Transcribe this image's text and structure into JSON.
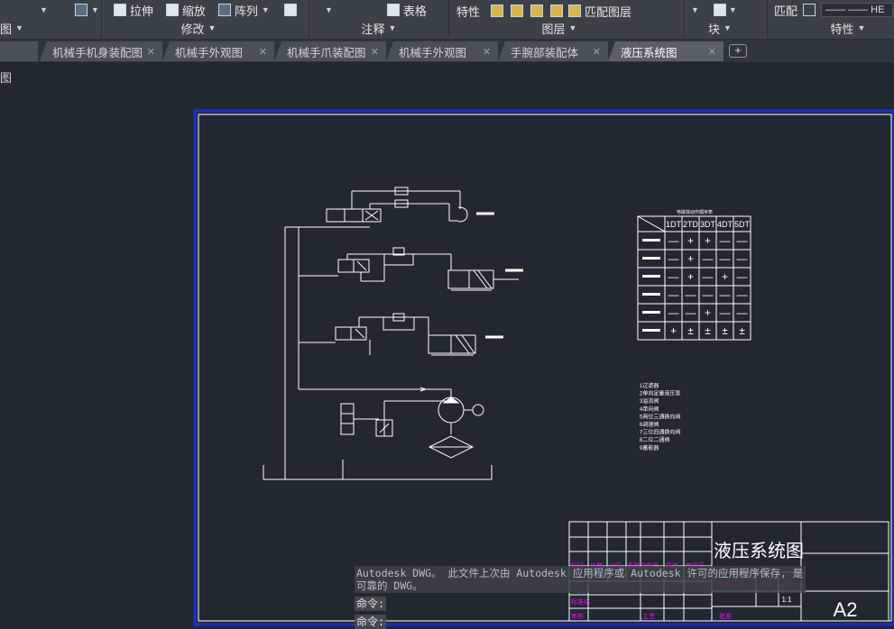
{
  "ribbon": {
    "row1": [
      {
        "name": "view-dropdown",
        "label": ""
      },
      {
        "name": "stretch-button",
        "label": "拉伸"
      },
      {
        "name": "scale-button",
        "label": "缩放"
      },
      {
        "name": "array-button",
        "label": "阵列"
      },
      {
        "name": "table-button",
        "label": "表格"
      },
      {
        "name": "properties-label-top",
        "label": "特性"
      },
      {
        "name": "match-layer-button",
        "label": "匹配图层"
      },
      {
        "name": "match-button",
        "label": "匹配"
      },
      {
        "name": "linetype-label",
        "label": "HE"
      }
    ],
    "panels": {
      "left_cut": "图",
      "modify": "修改",
      "annotation": "注释",
      "layers": "图层",
      "block": "块",
      "properties": "特性"
    }
  },
  "tabs": [
    {
      "label": "机械手机身装配图",
      "active": false
    },
    {
      "label": "机械手外观图",
      "active": false
    },
    {
      "label": "机械手爪装配图",
      "active": false
    },
    {
      "label": "机械手外观图",
      "active": false
    },
    {
      "label": "手腕部装配体",
      "active": false
    },
    {
      "label": "液压系统图",
      "active": true
    }
  ],
  "tab_close_glyph": "✕",
  "tab_add_glyph": "+",
  "view_label": "图",
  "drawing": {
    "title": "液压系统图",
    "size": "A2",
    "scale": "1:1",
    "table_title": "电磁铁动作顺序表",
    "table_headers": [
      "1DT",
      "2TD",
      "3DT",
      "4DT",
      "5DT"
    ],
    "table_rows": [
      [
        "—",
        "+",
        "+",
        "—",
        "—"
      ],
      [
        "—",
        "+",
        "—",
        "—",
        "—"
      ],
      [
        "—",
        "+",
        "—",
        "+",
        "—"
      ],
      [
        "—",
        "—",
        "—",
        "—",
        "—"
      ],
      [
        "—",
        "—",
        "+",
        "—",
        "—"
      ],
      [
        "+",
        "±",
        "±",
        "±",
        "±"
      ]
    ],
    "parts_list": [
      "1过滤器",
      "2单向定量液压泵",
      "3溢流阀",
      "4单向阀",
      "5两位三通换向阀",
      "6调速阀",
      "7三位四通换向阀",
      "8二位二通阀",
      "9蓄能器"
    ],
    "titleblock_magenta": [
      "标记",
      "处数",
      "分区",
      "更改文件号",
      "签名",
      "年月日",
      "设计",
      "标准化",
      "阶段标记",
      "重量",
      "比例",
      "审核",
      "工艺",
      "批准",
      "共 七 张 第 七 张"
    ]
  },
  "command": {
    "message": "Autodesk DWG。 此文件上次由 Autodesk 应用程序或 Autodesk 许可的应用程序保存, 是可靠的 DWG。",
    "prompt1": "命令:",
    "prompt2": "命令:"
  },
  "colors": {
    "background": "#212830",
    "frame": "#1a2ed8",
    "line": "#ffffff",
    "magenta": "#ff00ff",
    "ribbon": "#3b4148"
  }
}
